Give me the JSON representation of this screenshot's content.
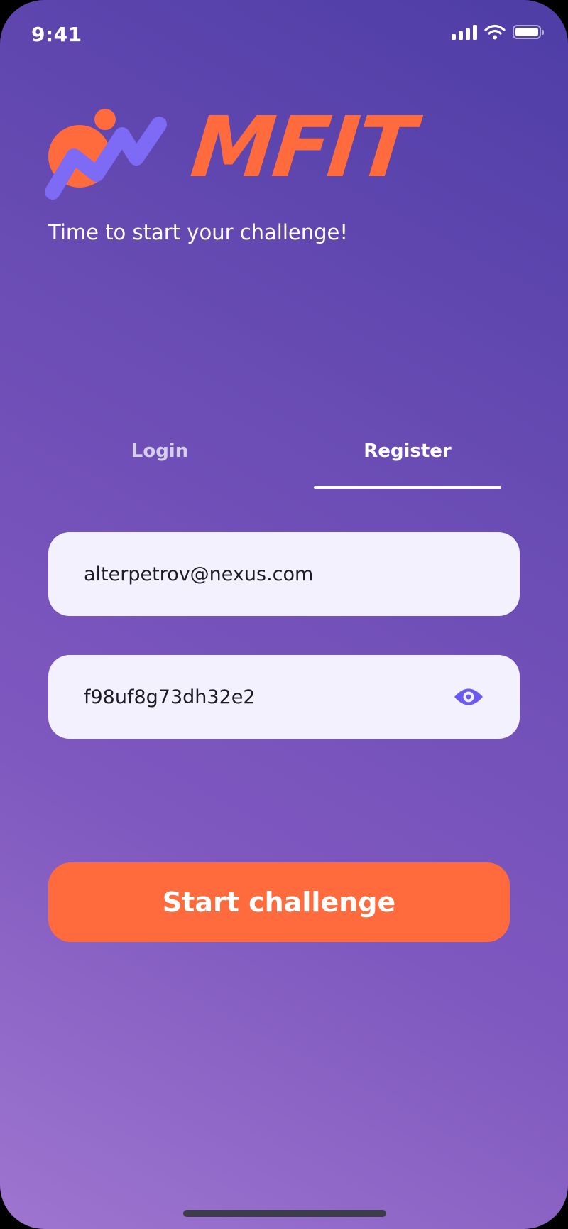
{
  "status_bar": {
    "time": "9:41",
    "icons": [
      "signal-icon",
      "wifi-icon",
      "battery-icon"
    ]
  },
  "brand": {
    "name": "MFIT",
    "tagline": "Time to start your challenge!",
    "logo_icon": "runner-logo-icon",
    "primary_color": "#ff6b3c",
    "secondary_color": "#7d6bf6"
  },
  "tabs": [
    {
      "label": "Login",
      "active": false
    },
    {
      "label": "Register",
      "active": true
    }
  ],
  "form": {
    "email_value": "alterpetrov@nexus.com",
    "password_value": "f98uf8g73dh32e2",
    "password_visibility_icon": "eye-icon"
  },
  "cta": {
    "label": "Start challenge"
  },
  "colors": {
    "background_top": "#4e3da6",
    "background_bottom": "#9e75cf",
    "field_background": "#f2f1fd",
    "eye_icon": "#6a5af0"
  }
}
